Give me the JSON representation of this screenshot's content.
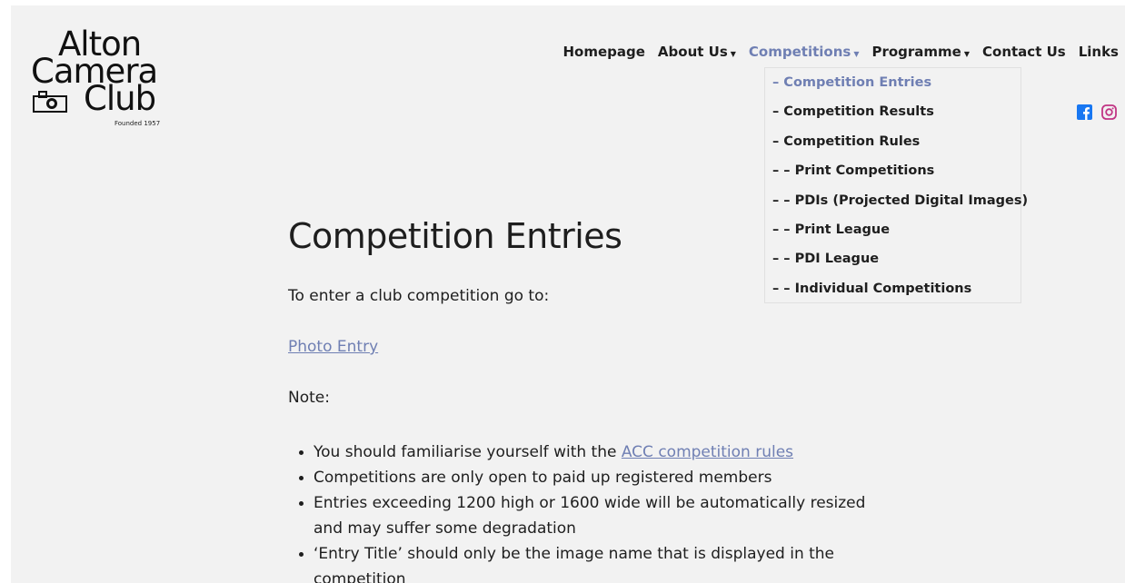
{
  "logo": {
    "line1": "Alton",
    "line2": "Camera",
    "line3": "Club",
    "founded": "Founded 1957"
  },
  "nav": {
    "items": [
      {
        "label": "Homepage"
      },
      {
        "label": "About Us"
      },
      {
        "label": "Competitions"
      },
      {
        "label": "Programme"
      },
      {
        "label": "Contact Us"
      },
      {
        "label": "Links"
      }
    ],
    "active_color": "#6f7fb3"
  },
  "dropdown": {
    "items": [
      {
        "label": "– Competition Entries"
      },
      {
        "label": "– Competition Results"
      },
      {
        "label": "– Competition Rules"
      },
      {
        "label": "– – Print Competitions"
      },
      {
        "label": "– – PDIs (Projected Digital Images)"
      },
      {
        "label": "– – Print League"
      },
      {
        "label": "– – PDI League"
      },
      {
        "label": "– – Individual Competitions"
      }
    ]
  },
  "social": {
    "icons": [
      "facebook-icon",
      "instagram-icon"
    ],
    "facebook_color": "#1877f2",
    "instagram_color": "#c13584"
  },
  "content": {
    "title": "Competition Entries",
    "intro": "To enter a club competition go to:",
    "photo_entry_link": "Photo Entry",
    "note": "Note:",
    "bullet1_prefix": "You should familiarise yourself with the ",
    "bullet1_link": "ACC competition rules",
    "bullet2": "Competitions are only open to paid up registered members",
    "bullet3": "Entries exceeding 1200 high or 1600 wide will be automatically resized and may suffer some degradation",
    "bullet4": "‘Entry Title’ should only be the image name that is displayed in the competition"
  }
}
